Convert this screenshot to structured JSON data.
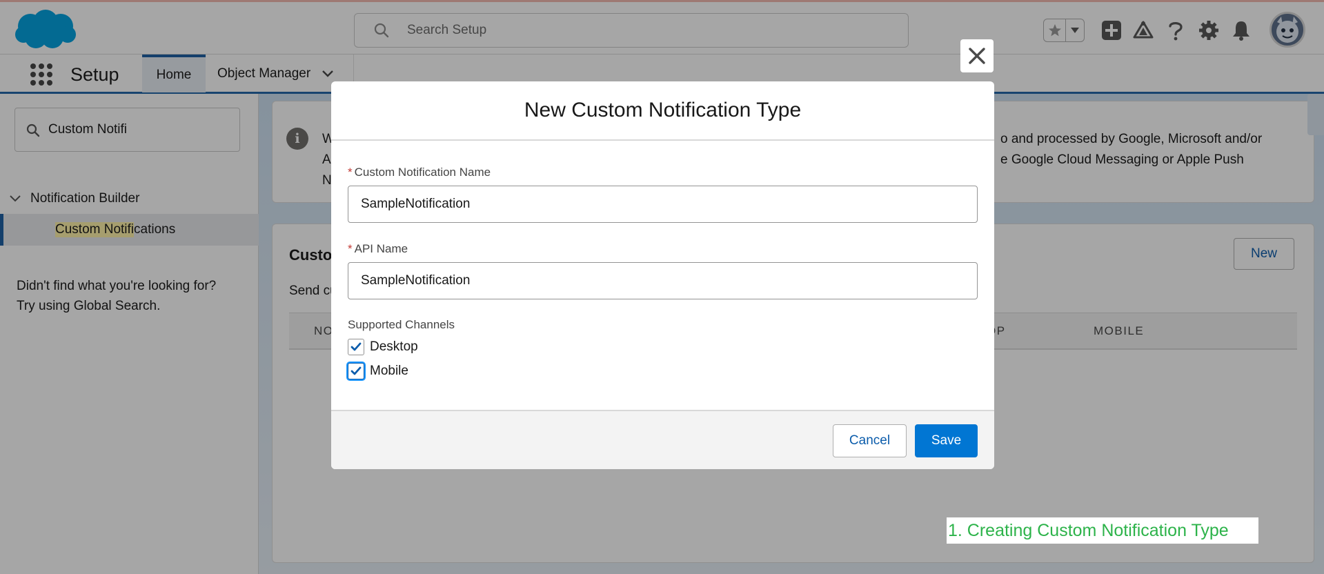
{
  "header": {
    "logo": "salesforce-cloud-logo",
    "search_placeholder": "Search Setup",
    "icons": [
      "star-icon",
      "chevron-down-icon",
      "add-icon",
      "trailhead-icon",
      "help-icon",
      "gear-icon",
      "bell-icon"
    ],
    "brand_color": "#00a1e0"
  },
  "nav": {
    "app_name": "Setup",
    "tabs": [
      {
        "label": "Home",
        "active": true
      },
      {
        "label": "Object Manager",
        "active": false
      }
    ]
  },
  "sidebar": {
    "quick_find_value": "Custom Notifi",
    "tree": {
      "parent_label": "Notification Builder",
      "child_label_highlight": "Custom Notifi",
      "child_label_rest": "cations"
    },
    "help_line1": "Didn't find what you're looking for?",
    "help_line2": "Try using Global Search."
  },
  "main": {
    "info_left_lines": [
      "W",
      "A",
      "N"
    ],
    "info_right_lines": [
      "o and processed by Google, Microsoft and/or",
      "e Google Cloud Messaging or Apple Push"
    ],
    "list_title": "Custo",
    "list_sub": "Send cu",
    "new_button": "New",
    "columns": [
      "NO",
      "OP",
      "MOBILE"
    ]
  },
  "modal": {
    "title": "New Custom Notification Type",
    "name_label": "Custom Notification Name",
    "name_value": "SampleNotification",
    "api_label": "API Name",
    "api_value": "SampleNotification",
    "required_mark": "*",
    "channels_label": "Supported Channels",
    "channels": [
      {
        "label": "Desktop",
        "checked": true
      },
      {
        "label": "Mobile",
        "checked": true
      }
    ],
    "cancel_label": "Cancel",
    "save_label": "Save",
    "accent_color": "#0176d3"
  },
  "caption": "1. Creating Custom Notification Type"
}
